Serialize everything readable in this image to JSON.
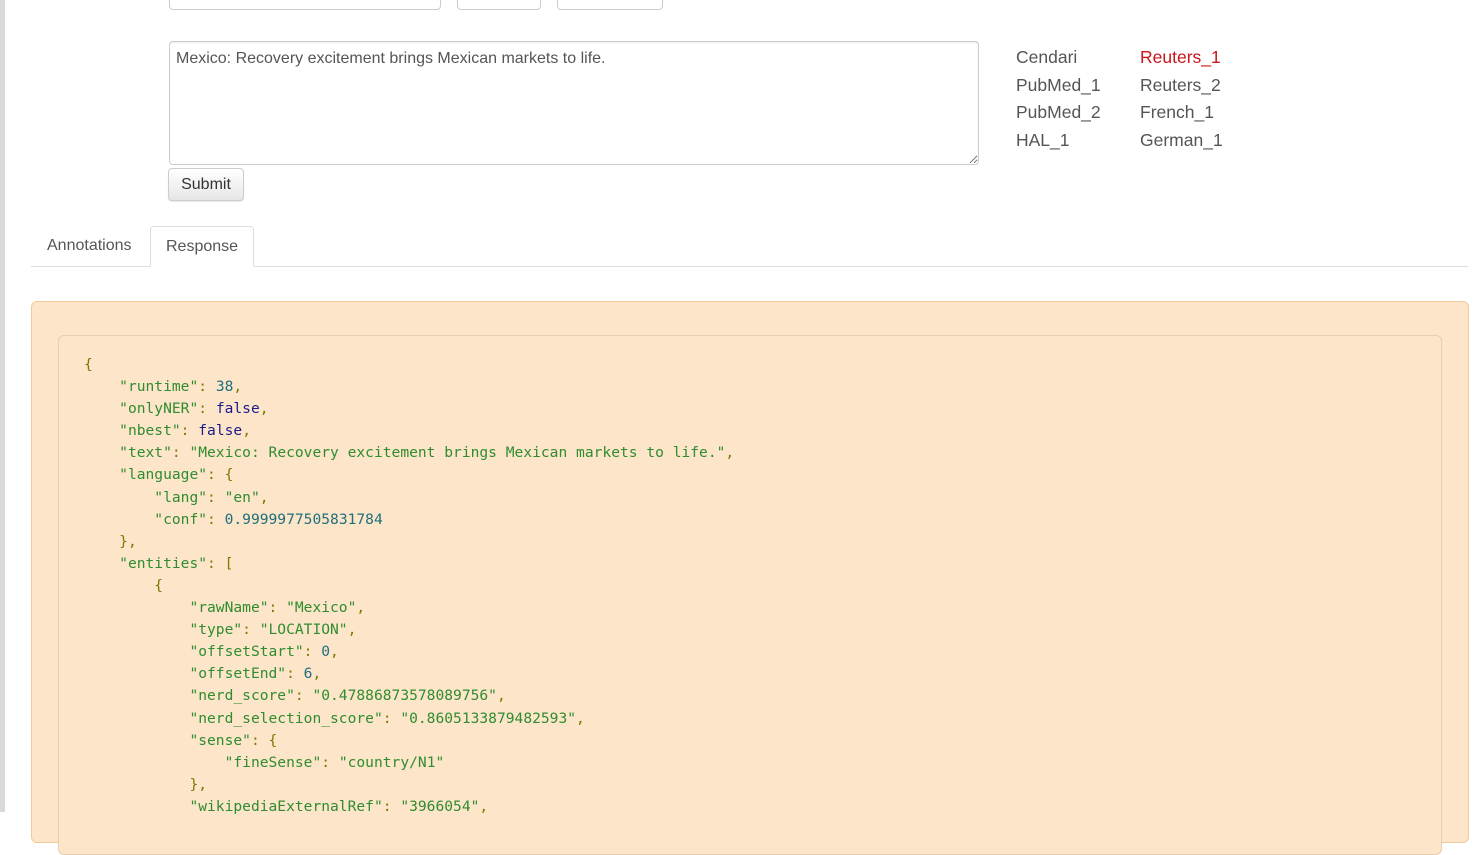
{
  "query": {
    "text": "Mexico: Recovery excitement brings Mexican markets to life.",
    "submit_label": "Submit"
  },
  "examples": [
    {
      "label": "Cendari",
      "active": false
    },
    {
      "label": "Reuters_1",
      "active": true
    },
    {
      "label": "PubMed_1",
      "active": false
    },
    {
      "label": "Reuters_2",
      "active": false
    },
    {
      "label": "PubMed_2",
      "active": false
    },
    {
      "label": "French_1",
      "active": false
    },
    {
      "label": "HAL_1",
      "active": false
    },
    {
      "label": "German_1",
      "active": false
    }
  ],
  "tabs": [
    {
      "label": "Annotations",
      "active": false
    },
    {
      "label": "Response",
      "active": true
    }
  ],
  "response": {
    "runtime": "38",
    "onlyNER": "false",
    "nbest": "false",
    "text": "\"Mexico: Recovery excitement brings Mexican markets to life.\"",
    "lang": "\"en\"",
    "conf": "0.9999977505831784",
    "rawName": "\"Mexico\"",
    "type": "\"LOCATION\"",
    "offsetStart": "0",
    "offsetEnd": "6",
    "nerd_score": "\"0.47886873578089756\"",
    "nerd_selection_score": "\"0.8605133879482593\"",
    "fineSense": "\"country/N1\"",
    "wikipediaExternalRef": "\"3966054\""
  },
  "colors": {
    "active_example": "#c9141b",
    "panel_bg": "#fce5c9",
    "json_key": "#2f8c2f",
    "json_number": "#1f6f7a",
    "json_bool": "#1b1b8c"
  }
}
